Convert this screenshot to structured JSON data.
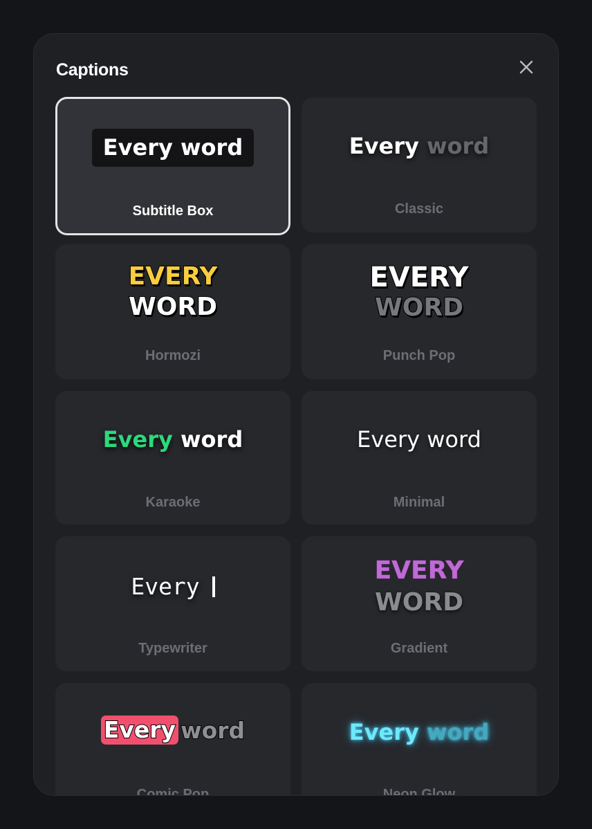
{
  "panel": {
    "title": "Captions",
    "close_icon": "close-icon"
  },
  "selected_style": "Subtitle Box",
  "styles": [
    {
      "label": "Subtitle Box",
      "preview": {
        "line1": "Every word"
      }
    },
    {
      "label": "Classic",
      "preview": {
        "first": "Every",
        "second": "word"
      }
    },
    {
      "label": "Hormozi",
      "preview": {
        "line1": "EVERY",
        "line2": "WORD"
      }
    },
    {
      "label": "Punch Pop",
      "preview": {
        "line1": "EVERY",
        "line2": "WORD"
      }
    },
    {
      "label": "Karaoke",
      "preview": {
        "first": "Every",
        "second": "word"
      }
    },
    {
      "label": "Minimal",
      "preview": {
        "line1": "Every word"
      }
    },
    {
      "label": "Typewriter",
      "preview": {
        "line1": "Every"
      }
    },
    {
      "label": "Gradient",
      "preview": {
        "line1": "EVERY",
        "line2": "WORD"
      }
    },
    {
      "label": "Comic Pop",
      "preview": {
        "first": "Every",
        "second": "word"
      }
    },
    {
      "label": "Neon Glow",
      "preview": {
        "first": "Every",
        "second": "word"
      }
    }
  ],
  "colors": {
    "accent_yellow": "#f9cd3f",
    "karaoke_green": "#2bd97c",
    "gradient_purple": "#c06ad6",
    "comic_pink": "#f0506e",
    "neon_cyan": "#6ee8fb"
  }
}
